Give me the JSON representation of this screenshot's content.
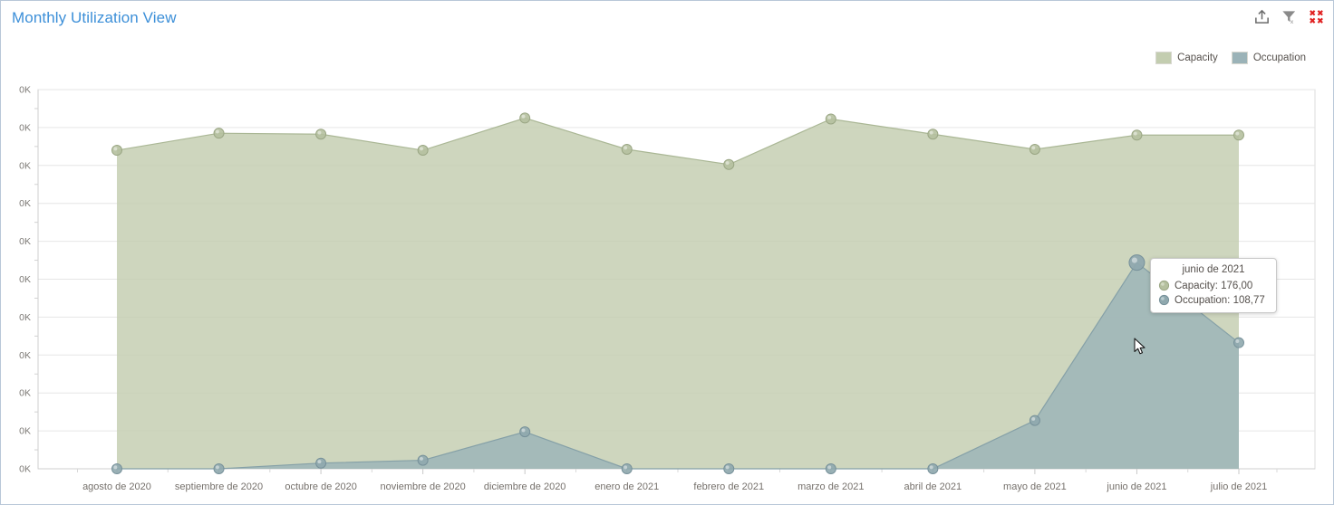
{
  "window": {
    "title": "Monthly Utilization View"
  },
  "toolbar": {
    "export_label": "export-icon",
    "clear_filter_label": "clear-filter-icon",
    "collapse_label": "collapse-icon"
  },
  "legend": {
    "items": [
      {
        "label": "Capacity",
        "color": "#c3cdb0"
      },
      {
        "label": "Occupation",
        "color": "#9bb3b8"
      }
    ]
  },
  "tooltip": {
    "title": "junio de 2021",
    "rows": [
      {
        "label": "Capacity: 176,00",
        "color": "#c3cdb0"
      },
      {
        "label": "Occupation: 108,77",
        "color": "#9bb3b8"
      }
    ]
  },
  "chart_data": {
    "type": "area",
    "title": "Monthly Utilization View",
    "xlabel": "",
    "ylabel": "",
    "grid": true,
    "legend_position": "top-right",
    "ylim": [
      0,
      200
    ],
    "ytick_labels": [
      "0K",
      "0K",
      "0K",
      "0K",
      "0K",
      "0K",
      "0K",
      "0K",
      "0K",
      "0K",
      "0K"
    ],
    "ytick_values": [
      200,
      180,
      160,
      140,
      120,
      100,
      80,
      60,
      40,
      20,
      0
    ],
    "categories": [
      "agosto de 2020",
      "septiembre de 2020",
      "octubre de 2020",
      "noviembre de 2020",
      "diciembre de 2020",
      "enero de 2021",
      "febrero de 2021",
      "marzo de 2021",
      "abril de 2021",
      "mayo de 2021",
      "junio de 2021",
      "julio de 2021"
    ],
    "series": [
      {
        "name": "Capacity",
        "color": "#c3cdb0",
        "values": [
          168,
          177,
          176.5,
          168,
          185,
          168.5,
          160.5,
          184.5,
          176.5,
          168.5,
          176,
          176
        ]
      },
      {
        "name": "Occupation",
        "color": "#9bb3b8",
        "values": [
          0,
          0,
          3,
          4.5,
          19.5,
          0,
          0,
          0,
          0,
          25.5,
          108.77,
          66.5
        ]
      }
    ],
    "highlighted_point": {
      "series": "Occupation",
      "category": "junio de 2021",
      "value": 108.77
    }
  }
}
